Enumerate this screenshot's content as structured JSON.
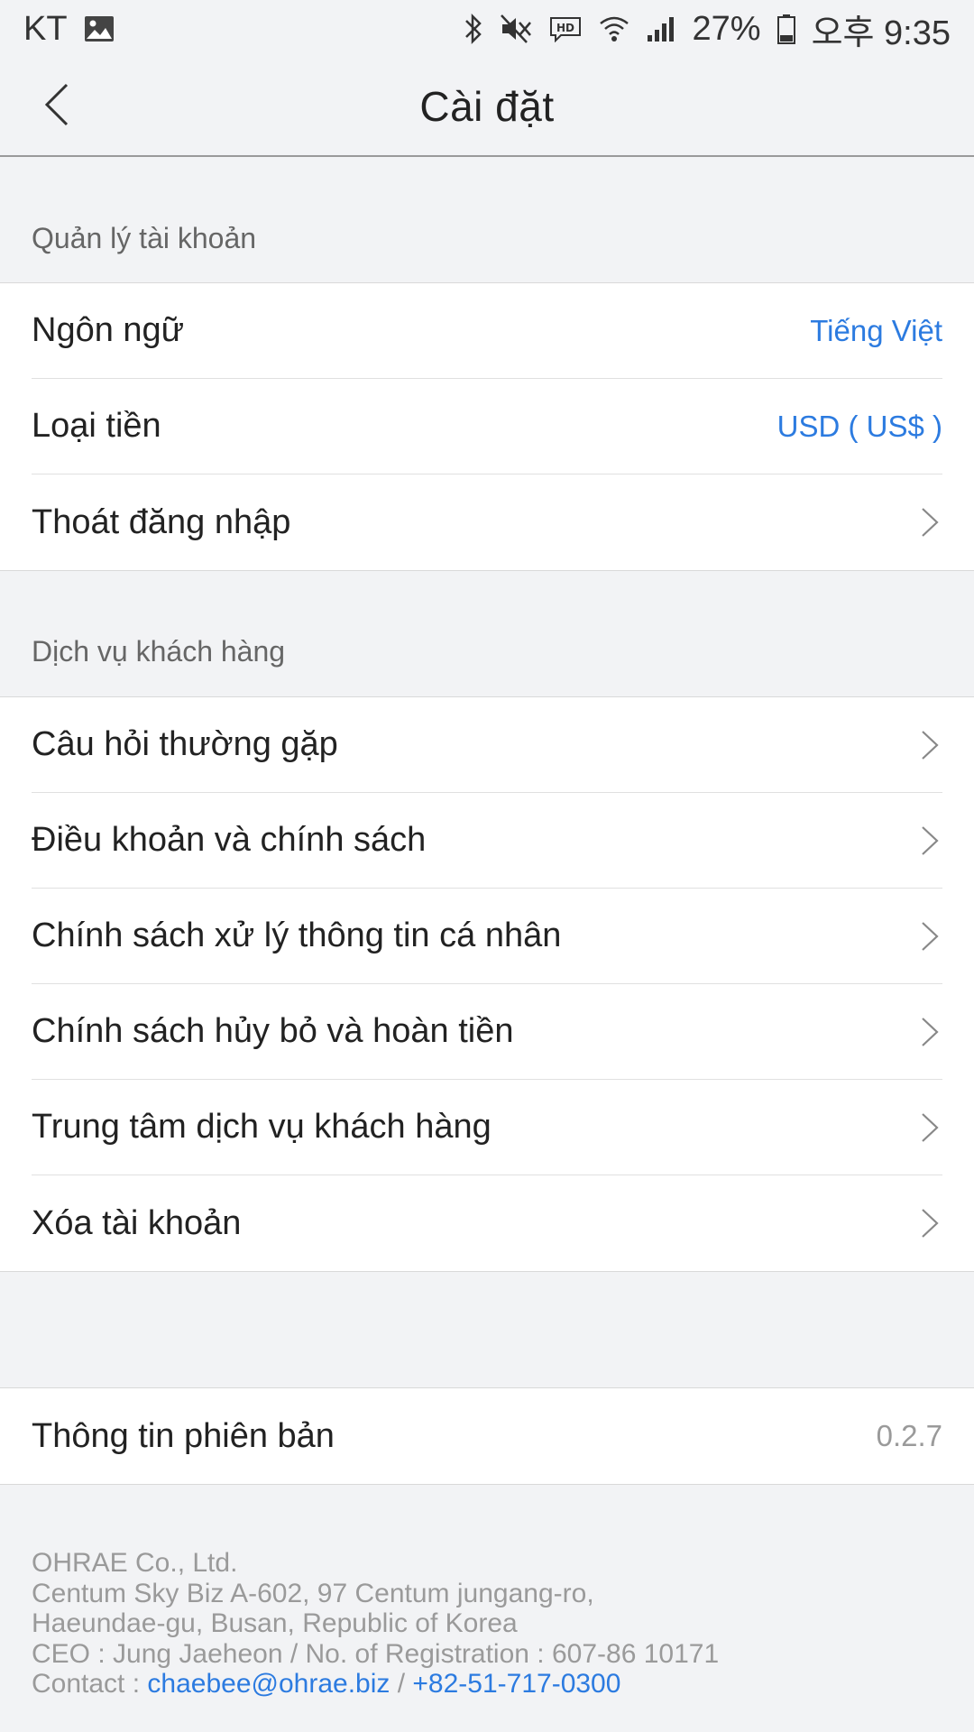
{
  "status_bar": {
    "carrier": "KT",
    "battery": "27%",
    "time": "오후 9:35",
    "icons": [
      "image-icon",
      "bluetooth-icon",
      "mute-icon",
      "hd-icon",
      "wifi-icon",
      "signal-icon",
      "battery-icon"
    ]
  },
  "header": {
    "title": "Cài đặt"
  },
  "account": {
    "section_title": "Quản lý tài khoản",
    "language_label": "Ngôn ngữ",
    "language_value": "Tiếng Việt",
    "currency_label": "Loại tiền",
    "currency_value": "USD ( US$ )",
    "logout_label": "Thoát đăng nhập"
  },
  "support": {
    "section_title": "Dịch vụ khách hàng",
    "items": [
      {
        "label": "Câu hỏi thường gặp"
      },
      {
        "label": "Điều khoản và chính sách"
      },
      {
        "label": "Chính sách xử lý thông tin cá nhân"
      },
      {
        "label": "Chính sách hủy bỏ và hoàn tiền"
      },
      {
        "label": "Trung tâm dịch vụ khách hàng"
      },
      {
        "label": "Xóa tài khoản"
      }
    ]
  },
  "version": {
    "label": "Thông tin phiên bản",
    "value": "0.2.7"
  },
  "footer": {
    "company": "OHRAE Co., Ltd.",
    "address_line1": "Centum Sky Biz A-602, 97 Centum jungang-ro,",
    "address_line2": "Haeundae-gu, Busan, Republic of Korea",
    "ceo_line": "CEO : Jung Jaeheon / No. of Registration : 607-86 10171",
    "contact_prefix": "Contact : ",
    "email": "chaebee@ohrae.biz",
    "separator": " / ",
    "phone": "+82-51-717-0300"
  },
  "colors": {
    "accent": "#2c7be0",
    "background": "#f2f3f5",
    "muted_text": "#9a9a9a"
  }
}
